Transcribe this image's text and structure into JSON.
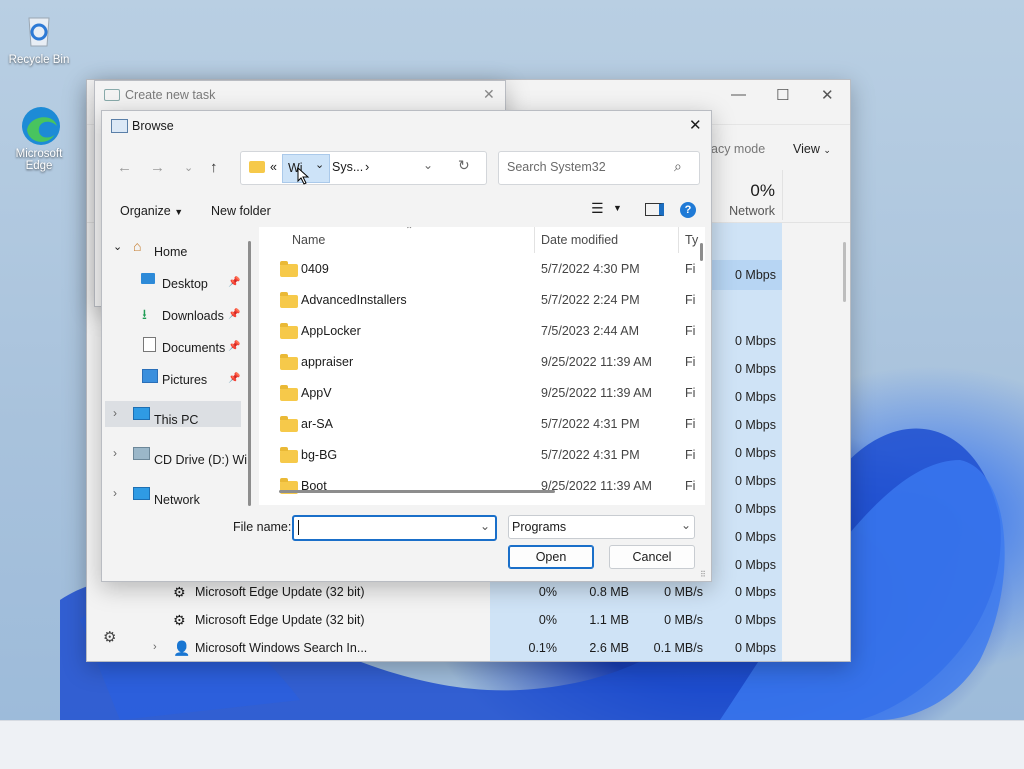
{
  "desktop": {
    "icons": [
      {
        "label": "Recycle Bin",
        "icon": "recycle-bin-icon"
      },
      {
        "label": "Microsoft Edge",
        "icon": "edge-icon"
      }
    ]
  },
  "task_manager": {
    "efficiency_label": "acy mode",
    "view_label": "View",
    "network_percent": "0%",
    "network_label": "Network",
    "column_header_short": "Mbps",
    "network_values": [
      "0 Mbps",
      "0 Mbps",
      "0 Mbps",
      "0 Mbps",
      "0 Mbps",
      "0 Mbps",
      "0 Mbps",
      "0 Mbps",
      "0 Mbps",
      "0 Mbps"
    ],
    "processes": [
      {
        "name": "Microsoft Edge Update (32 bit)",
        "cpu": "0%",
        "memory": "0.8 MB",
        "disk": "0 MB/s",
        "network": "0 Mbps"
      },
      {
        "name": "Microsoft Edge Update (32 bit)",
        "cpu": "0%",
        "memory": "1.1 MB",
        "disk": "0 MB/s",
        "network": "0 Mbps"
      },
      {
        "name": "Microsoft Windows Search In...",
        "cpu": "0.1%",
        "memory": "2.6 MB",
        "disk": "0.1 MB/s",
        "network": "0 Mbps"
      }
    ]
  },
  "create_task": {
    "title": "Create new task"
  },
  "browse": {
    "title": "Browse",
    "breadcrumb": {
      "overflow": "«",
      "segment1": "Wi",
      "segment2": "Sys...",
      "sep": "›"
    },
    "search_placeholder": "Search System32",
    "organize_label": "Organize",
    "new_folder_label": "New folder",
    "nav": {
      "home": "Home",
      "desktop": "Desktop",
      "downloads": "Downloads",
      "documents": "Documents",
      "pictures": "Pictures",
      "this_pc": "This PC",
      "cd_drive": "CD Drive (D:) Wir",
      "network": "Network"
    },
    "columns": {
      "name": "Name",
      "date": "Date modified",
      "type": "Ty"
    },
    "files": [
      {
        "name": "0409",
        "date": "5/7/2022 4:30 PM",
        "type": "Fi"
      },
      {
        "name": "AdvancedInstallers",
        "date": "5/7/2022 2:24 PM",
        "type": "Fi"
      },
      {
        "name": "AppLocker",
        "date": "7/5/2023 2:44 AM",
        "type": "Fi"
      },
      {
        "name": "appraiser",
        "date": "9/25/2022 11:39 AM",
        "type": "Fi"
      },
      {
        "name": "AppV",
        "date": "9/25/2022 11:39 AM",
        "type": "Fi"
      },
      {
        "name": "ar-SA",
        "date": "5/7/2022 4:31 PM",
        "type": "Fi"
      },
      {
        "name": "bg-BG",
        "date": "5/7/2022 4:31 PM",
        "type": "Fi"
      },
      {
        "name": "Boot",
        "date": "9/25/2022 11:39 AM",
        "type": "Fi"
      }
    ],
    "file_name_label": "File name:",
    "file_name_value": "",
    "file_type_value": "Programs",
    "open_label": "Open",
    "cancel_label": "Cancel"
  }
}
